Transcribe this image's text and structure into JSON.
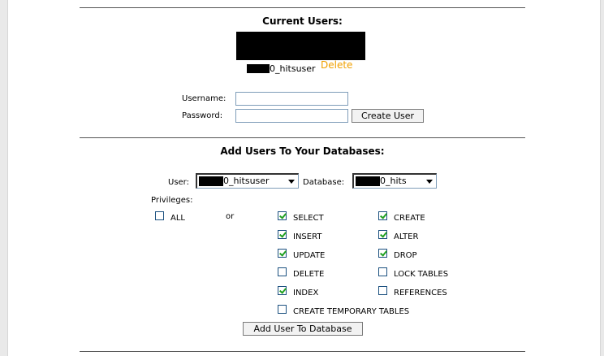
{
  "current_users": {
    "title": "Current Users:",
    "users": [
      {
        "name_suffix": "0_hitsuser",
        "delete_label": "Delete"
      }
    ]
  },
  "create_form": {
    "username_label": "Username:",
    "password_label": "Password:",
    "username_value": "",
    "password_value": "",
    "create_button": "Create User"
  },
  "add_users": {
    "title": "Add Users To Your Databases:",
    "user_label": "User:",
    "user_selected_suffix": "0_hitsuser",
    "database_label": "Database:",
    "database_selected_suffix": "0_hits",
    "privileges_label": "Privileges:",
    "all_label": "ALL",
    "all_checked": false,
    "or_label": "or",
    "privileges": [
      {
        "name": "SELECT",
        "checked": true
      },
      {
        "name": "CREATE",
        "checked": true
      },
      {
        "name": "INSERT",
        "checked": true
      },
      {
        "name": "ALTER",
        "checked": true
      },
      {
        "name": "UPDATE",
        "checked": true
      },
      {
        "name": "DROP",
        "checked": true
      },
      {
        "name": "DELETE",
        "checked": false
      },
      {
        "name": "LOCK TABLES",
        "checked": false
      },
      {
        "name": "INDEX",
        "checked": true
      },
      {
        "name": "REFERENCES",
        "checked": false
      },
      {
        "name": "CREATE TEMPORARY TABLES",
        "checked": false
      }
    ],
    "add_button": "Add User To Database"
  },
  "colors": {
    "delete_link": "#f0a000",
    "check": "#21a121"
  }
}
